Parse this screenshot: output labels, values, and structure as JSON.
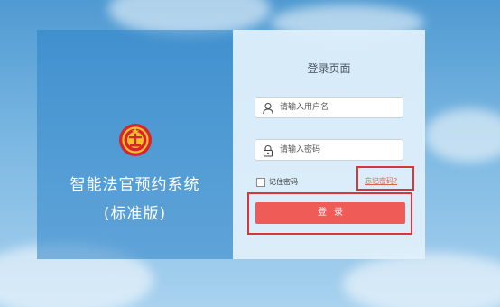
{
  "brand": {
    "system_name": "智能法官预约系统",
    "edition": "(标准版)",
    "emblem_icon": "court-emblem-icon"
  },
  "form": {
    "title": "登录页面",
    "username": {
      "placeholder": "请输入用户名",
      "value": "",
      "icon": "user-icon"
    },
    "password": {
      "placeholder": "请输入密码",
      "value": "",
      "icon": "lock-icon"
    },
    "remember_label": "记住密码",
    "remember_checked": false,
    "forgot_label": "忘记密码?",
    "login_label": "登录"
  },
  "colors": {
    "login_button": "#ef5b57",
    "forgot_link": "#e0614e",
    "highlight_box": "#d9353a",
    "brand_panel": "#2d84c8"
  }
}
